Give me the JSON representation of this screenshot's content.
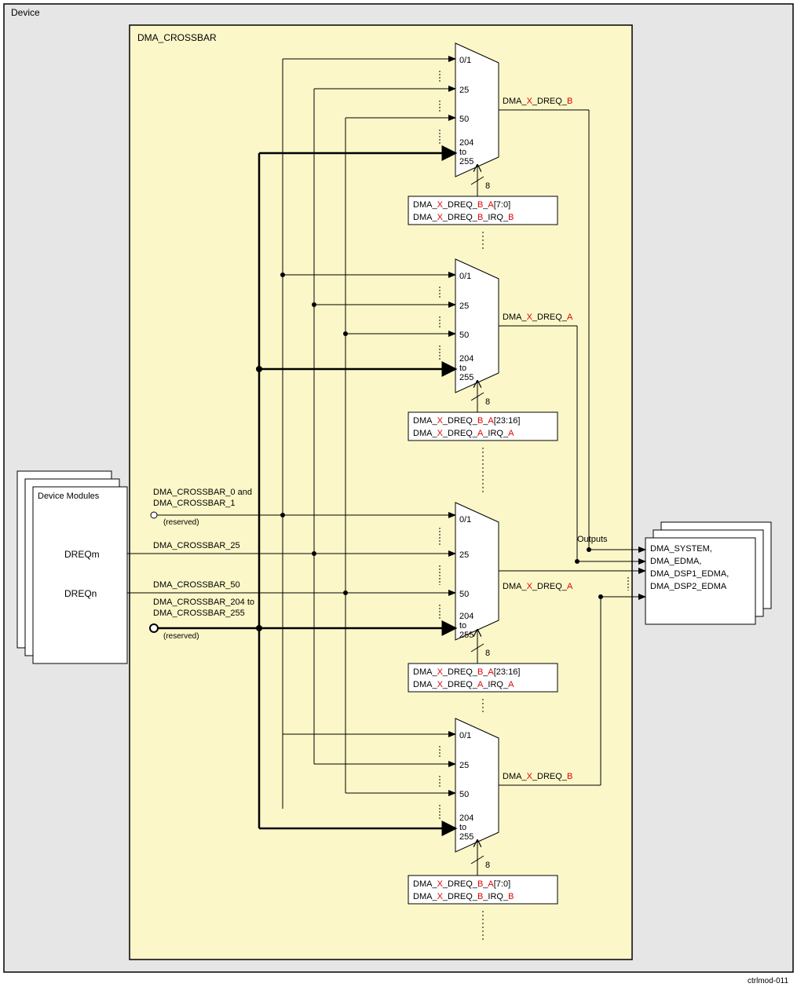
{
  "outer_label": "Device",
  "crossbar_label": "DMA_CROSSBAR",
  "footer_id": "ctrlmod-011",
  "left_panel": {
    "title": "Device Modules",
    "dreq_m": "DREQm",
    "dreq_n": "DREQn"
  },
  "right_panel": {
    "outputs_label": "Outputs",
    "lines": [
      "DMA_SYSTEM,",
      "DMA_EDMA,",
      "DMA_DSP1_EDMA,",
      "DMA_DSP2_EDMA"
    ]
  },
  "input_lines": {
    "l0_a": "DMA_CROSSBAR_0 and",
    "l0_b": "DMA_CROSSBAR_1",
    "l0_res": "(reserved)",
    "l25": "DMA_CROSSBAR_25",
    "l50": "DMA_CROSSBAR_50",
    "l204_a": "DMA_CROSSBAR_204 to",
    "l204_b": "DMA_CROSSBAR_255",
    "l204_res": "(reserved)"
  },
  "mux_ports": {
    "p0": "0/1",
    "p25": "25",
    "p50": "50",
    "p204_a": "204",
    "p204_b": "to",
    "p204_c": "255"
  },
  "selectors": {
    "width8": "8",
    "reg1_a_pre": "DMA_",
    "reg1_a_x": "X",
    "reg1_a_mid": "_DREQ_",
    "reg1_a_b": "B",
    "reg1_a_mid2": "_",
    "reg1_a_a": "A",
    "reg1_a_suf": "[7:0]",
    "reg1_b_pre": "DMA_",
    "reg1_b_x": "X",
    "reg1_b_mid": "_DREQ_",
    "reg1_b_b": "B",
    "reg1_b_mid2": "_IRQ_",
    "reg1_b_b2": "B",
    "reg2_a_pre": "DMA_",
    "reg2_a_x": "X",
    "reg2_a_mid": "_DREQ_",
    "reg2_a_b": "B",
    "reg2_a_mid2": "_",
    "reg2_a_a": "A",
    "reg2_a_suf": "[23:16]",
    "reg2_b_pre": "DMA_",
    "reg2_b_x": "X",
    "reg2_b_mid": "_DREQ_",
    "reg2_b_a": "A",
    "reg2_b_mid2": "_IRQ_",
    "reg2_b_a2": "A",
    "reg3_a_pre": "DMA_",
    "reg3_a_x": "X",
    "reg3_a_mid": "_DREQ_",
    "reg3_a_b": "B",
    "reg3_a_mid2": "_",
    "reg3_a_a": "A",
    "reg3_a_suf": "[23:16]",
    "reg3_b_pre": "DMA_",
    "reg3_b_x": "X",
    "reg3_b_mid": "_DREQ_",
    "reg3_b_a": "A",
    "reg3_b_mid2": "_IRQ_",
    "reg3_b_a2": "A",
    "reg4_a_pre": "DMA_",
    "reg4_a_x": "X",
    "reg4_a_mid": "_DREQ_",
    "reg4_a_b": "B",
    "reg4_a_mid2": "_",
    "reg4_a_a": "A",
    "reg4_a_suf": "[7:0]",
    "reg4_b_pre": "DMA_",
    "reg4_b_x": "X",
    "reg4_b_mid": "_DREQ_",
    "reg4_b_b": "B",
    "reg4_b_mid2": "_IRQ_",
    "reg4_b_b2": "B"
  },
  "out_labels": {
    "o1_pre": "DMA_",
    "o1_x": "X",
    "o1_mid": "_DREQ_",
    "o1_s": "B",
    "o2_pre": "DMA_",
    "o2_x": "X",
    "o2_mid": "_DREQ_",
    "o2_s": "A",
    "o3_pre": "DMA_",
    "o3_x": "X",
    "o3_mid": "_DREQ_",
    "o3_s": "A",
    "o4_pre": "DMA_",
    "o4_x": "X",
    "o4_mid": "_DREQ_",
    "o4_s": "B"
  }
}
